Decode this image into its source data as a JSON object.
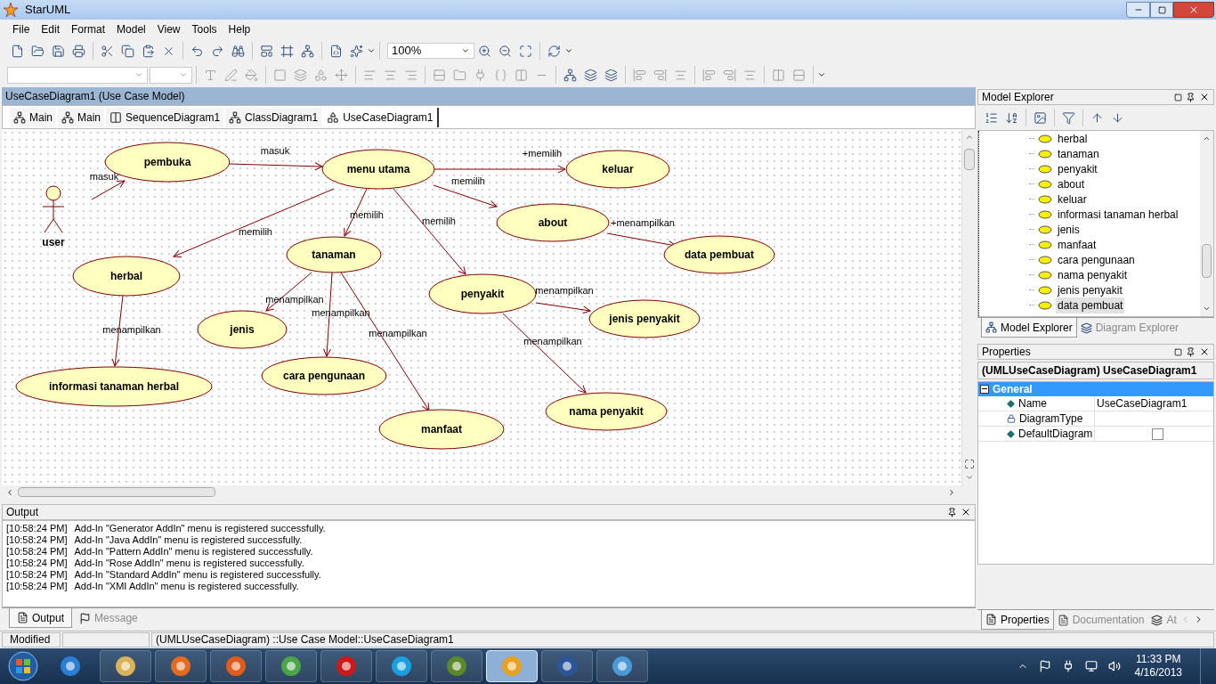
{
  "window": {
    "title": "StarUML"
  },
  "menu": [
    "File",
    "Edit",
    "Format",
    "Model",
    "View",
    "Tools",
    "Help"
  ],
  "zoom": {
    "value": "100%"
  },
  "document": {
    "title": "UseCaseDiagram1 (Use Case Model)"
  },
  "diagram_tabs": [
    {
      "label": "Main",
      "kind": "class",
      "selected": false
    },
    {
      "label": "Main",
      "kind": "class",
      "selected": false
    },
    {
      "label": "SequenceDiagram1",
      "kind": "sequence",
      "selected": false
    },
    {
      "label": "ClassDiagram1",
      "kind": "class",
      "selected": false
    },
    {
      "label": "UseCaseDiagram1",
      "kind": "usecase",
      "selected": true
    }
  ],
  "diagram": {
    "actor": {
      "label": "user"
    },
    "use_cases": [
      {
        "label": "pembuka"
      },
      {
        "label": "menu utama"
      },
      {
        "label": "keluar"
      },
      {
        "label": "about"
      },
      {
        "label": "herbal"
      },
      {
        "label": "tanaman"
      },
      {
        "label": "data pembuat"
      },
      {
        "label": "penyakit"
      },
      {
        "label": "jenis"
      },
      {
        "label": "jenis penyakit"
      },
      {
        "label": "informasi tanaman herbal"
      },
      {
        "label": "cara pengunaan"
      },
      {
        "label": "manfaat"
      },
      {
        "label": "nama penyakit"
      }
    ],
    "associations": [
      {
        "label": "masuk"
      },
      {
        "label": "masuk"
      },
      {
        "label": "+memilih"
      },
      {
        "label": "memilih"
      },
      {
        "label": "memilih"
      },
      {
        "label": "memilih"
      },
      {
        "label": "memilih"
      },
      {
        "label": "+menampilkan"
      },
      {
        "label": "menampilkan"
      },
      {
        "label": "menampilkan"
      },
      {
        "label": "menampilkan"
      },
      {
        "label": "menampilkan"
      },
      {
        "label": "menampilkan"
      },
      {
        "label": "menampilkan"
      }
    ]
  },
  "model_explorer": {
    "title": "Model Explorer",
    "items": [
      {
        "label": "herbal",
        "selected": false
      },
      {
        "label": "tanaman",
        "selected": false
      },
      {
        "label": "penyakit",
        "selected": false
      },
      {
        "label": "about",
        "selected": false
      },
      {
        "label": "keluar",
        "selected": false
      },
      {
        "label": "informasi tanaman herbal",
        "selected": false
      },
      {
        "label": "jenis",
        "selected": false
      },
      {
        "label": "manfaat",
        "selected": false
      },
      {
        "label": "cara pengunaan",
        "selected": false
      },
      {
        "label": "nama penyakit",
        "selected": false
      },
      {
        "label": "jenis penyakit",
        "selected": false
      },
      {
        "label": "data pembuat",
        "selected": true
      }
    ],
    "tabs": [
      {
        "label": "Model Explorer",
        "selected": true
      },
      {
        "label": "Diagram Explorer",
        "selected": false
      }
    ]
  },
  "properties": {
    "title": "Properties",
    "object": "(UMLUseCaseDiagram) UseCaseDiagram1",
    "group": {
      "label": "General",
      "expanded": true
    },
    "rows": [
      {
        "name": "Name",
        "kind": "text",
        "locked": false,
        "value": "UseCaseDiagram1"
      },
      {
        "name": "DiagramType",
        "kind": "text",
        "locked": true
      },
      {
        "name": "DefaultDiagram",
        "kind": "checkbox",
        "locked": false,
        "checked": false
      }
    ],
    "tabs": [
      {
        "label": "Properties",
        "selected": true
      },
      {
        "label": "Documentation",
        "selected": false
      },
      {
        "label": "At",
        "selected": false
      }
    ]
  },
  "output": {
    "title": "Output",
    "lines": [
      {
        "time": "[10:58:24 PM]",
        "text": "Add-In \"Generator AddIn\" menu is registered successfully."
      },
      {
        "time": "[10:58:24 PM]",
        "text": "Add-In \"Java AddIn\" menu is registered successfully."
      },
      {
        "time": "[10:58:24 PM]",
        "text": "Add-In \"Pattern AddIn\" menu is registered successfully."
      },
      {
        "time": "[10:58:24 PM]",
        "text": "Add-In \"Rose AddIn\" menu is registered successfully."
      },
      {
        "time": "[10:58:24 PM]",
        "text": "Add-In \"Standard AddIn\" menu is registered successfully."
      },
      {
        "time": "[10:58:24 PM]",
        "text": "Add-In \"XMI AddIn\" menu is registered successfully."
      }
    ],
    "tabs": [
      {
        "label": "Output",
        "selected": true
      },
      {
        "label": "Message",
        "selected": false
      }
    ]
  },
  "status_bar": {
    "state": "Modified",
    "path": "(UMLUseCaseDiagram) ::Use Case Model::UseCaseDiagram1"
  },
  "taskbar": {
    "apps": [
      {
        "active": false
      },
      {
        "active": false
      },
      {
        "active": false
      },
      {
        "active": false
      },
      {
        "active": false
      },
      {
        "active": false
      },
      {
        "active": false
      },
      {
        "active": false
      },
      {
        "active": true
      },
      {
        "active": false
      },
      {
        "active": false
      }
    ],
    "time": "11:33 PM",
    "date": "4/16/2013"
  }
}
